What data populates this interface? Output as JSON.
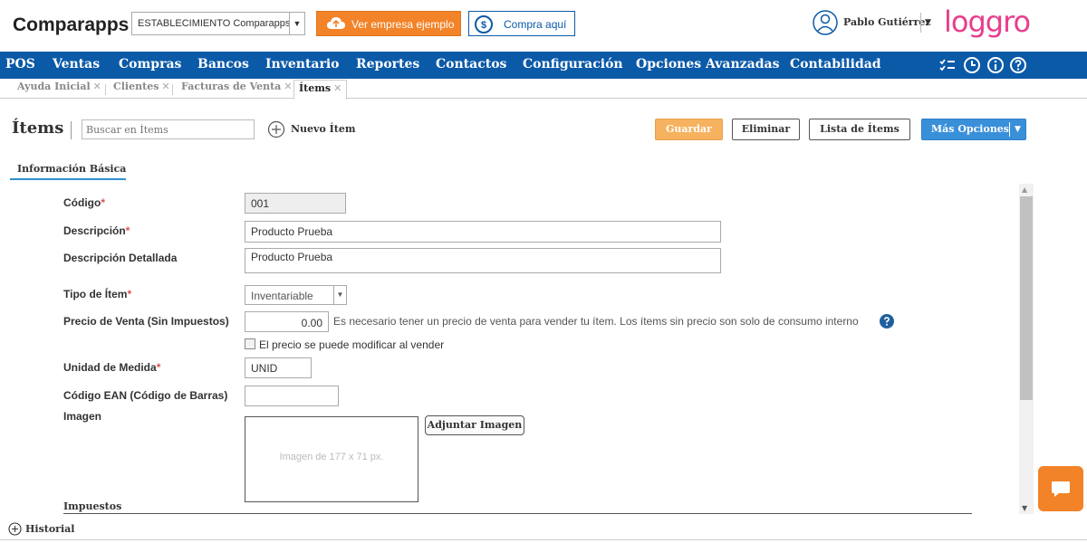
{
  "header": {
    "brand": "Comparapps",
    "establishment": "ESTABLECIMIENTO Comparapps",
    "example_button": "Ver empresa ejemplo",
    "buy_button": "Compra aquí",
    "user_name": "Pablo Gutiérrez",
    "logo_text": "loggro",
    "logo_color": "#e83e8c"
  },
  "nav": {
    "items": [
      "POS",
      "Ventas",
      "Compras",
      "Bancos",
      "Inventario",
      "Reportes",
      "Contactos",
      "Configuración",
      "Opciones Avanzadas",
      "Contabilidad"
    ],
    "icons": [
      "checklist-icon",
      "clock-icon",
      "info-icon",
      "help-icon"
    ],
    "color": "#0b5aa8"
  },
  "tabs": [
    {
      "label": "Ayuda Inicial"
    },
    {
      "label": "Clientes"
    },
    {
      "label": "Facturas de Venta"
    },
    {
      "label": "Ítems",
      "active": true
    }
  ],
  "toolbar": {
    "title": "Ítems",
    "search_placeholder": "Buscar en Ítems",
    "new_item": "Nuevo Ítem",
    "save": "Guardar",
    "delete": "Eliminar",
    "list": "Lista de Ítems",
    "more": "Más Opciones"
  },
  "section": {
    "tab": "Información Básica"
  },
  "form": {
    "code_label": "Código",
    "code_value": "001",
    "description_label": "Descripción",
    "description_value": "Producto Prueba",
    "detailed_label": "Descripción Detallada",
    "detailed_value": "Producto Prueba",
    "type_label": "Tipo de Ítem",
    "type_value": "Inventariable",
    "price_label": "Precio de Venta (Sin Impuestos)",
    "price_value": "0.00",
    "price_note": "Es necesario tener un precio de venta para vender tu ítem. Los ítems sin precio son solo de consumo interno",
    "price_editable_label": "El precio se puede modificar al vender",
    "unit_label": "Unidad de Medida",
    "unit_value": "UNID",
    "ean_label": "Código EAN (Código de Barras)",
    "ean_value": "",
    "image_label": "Imagen",
    "image_placeholder": "Imagen de 177 x 71 px.",
    "attach_button": "Adjuntar Imagen",
    "taxes_label": "Impuestos",
    "required_mark": "*"
  },
  "footer": {
    "history": "Historial"
  }
}
